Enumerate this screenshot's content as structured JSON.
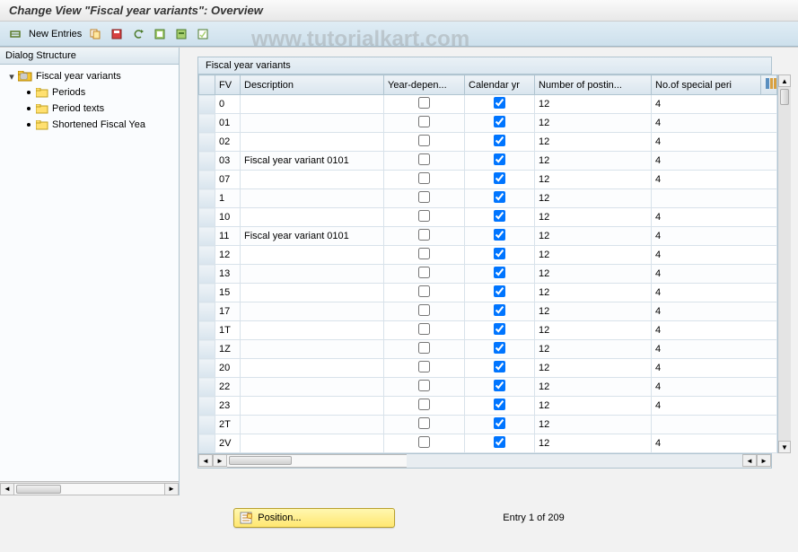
{
  "title": "Change View \"Fiscal year variants\": Overview",
  "watermark": "www.tutorialkart.com",
  "toolbar": {
    "new_entries": "New Entries"
  },
  "sidebar": {
    "title": "Dialog Structure",
    "root": "Fiscal year variants",
    "children": [
      "Periods",
      "Period texts",
      "Shortened Fiscal Yea"
    ]
  },
  "table": {
    "caption": "Fiscal year variants",
    "headers": {
      "fv": "FV",
      "desc": "Description",
      "yd": "Year-depen...",
      "cy": "Calendar yr",
      "np": "Number of postin...",
      "sp": "No.of special peri"
    },
    "rows": [
      {
        "fv": "0",
        "desc": "",
        "yd": false,
        "cy": true,
        "np": "12",
        "sp": "4"
      },
      {
        "fv": "01",
        "desc": "",
        "yd": false,
        "cy": true,
        "np": "12",
        "sp": "4"
      },
      {
        "fv": "02",
        "desc": "",
        "yd": false,
        "cy": true,
        "np": "12",
        "sp": "4"
      },
      {
        "fv": "03",
        "desc": "Fiscal year variant 0101",
        "yd": false,
        "cy": true,
        "np": "12",
        "sp": "4"
      },
      {
        "fv": "07",
        "desc": "",
        "yd": false,
        "cy": true,
        "np": "12",
        "sp": "4"
      },
      {
        "fv": "1",
        "desc": "",
        "yd": false,
        "cy": true,
        "np": "12",
        "sp": ""
      },
      {
        "fv": "10",
        "desc": "",
        "yd": false,
        "cy": true,
        "np": "12",
        "sp": "4"
      },
      {
        "fv": "11",
        "desc": "Fiscal year variant 0101",
        "yd": false,
        "cy": true,
        "np": "12",
        "sp": "4"
      },
      {
        "fv": "12",
        "desc": "",
        "yd": false,
        "cy": true,
        "np": "12",
        "sp": "4"
      },
      {
        "fv": "13",
        "desc": "",
        "yd": false,
        "cy": true,
        "np": "12",
        "sp": "4"
      },
      {
        "fv": "15",
        "desc": "",
        "yd": false,
        "cy": true,
        "np": "12",
        "sp": "4"
      },
      {
        "fv": "17",
        "desc": "",
        "yd": false,
        "cy": true,
        "np": "12",
        "sp": "4"
      },
      {
        "fv": "1T",
        "desc": "",
        "yd": false,
        "cy": true,
        "np": "12",
        "sp": "4"
      },
      {
        "fv": "1Z",
        "desc": "",
        "yd": false,
        "cy": true,
        "np": "12",
        "sp": "4"
      },
      {
        "fv": "20",
        "desc": "",
        "yd": false,
        "cy": true,
        "np": "12",
        "sp": "4"
      },
      {
        "fv": "22",
        "desc": "",
        "yd": false,
        "cy": true,
        "np": "12",
        "sp": "4"
      },
      {
        "fv": "23",
        "desc": "",
        "yd": false,
        "cy": true,
        "np": "12",
        "sp": "4"
      },
      {
        "fv": "2T",
        "desc": "",
        "yd": false,
        "cy": true,
        "np": "12",
        "sp": ""
      },
      {
        "fv": "2V",
        "desc": "",
        "yd": false,
        "cy": true,
        "np": "12",
        "sp": "4"
      }
    ]
  },
  "footer": {
    "position": "Position...",
    "entry": "Entry 1 of 209"
  }
}
